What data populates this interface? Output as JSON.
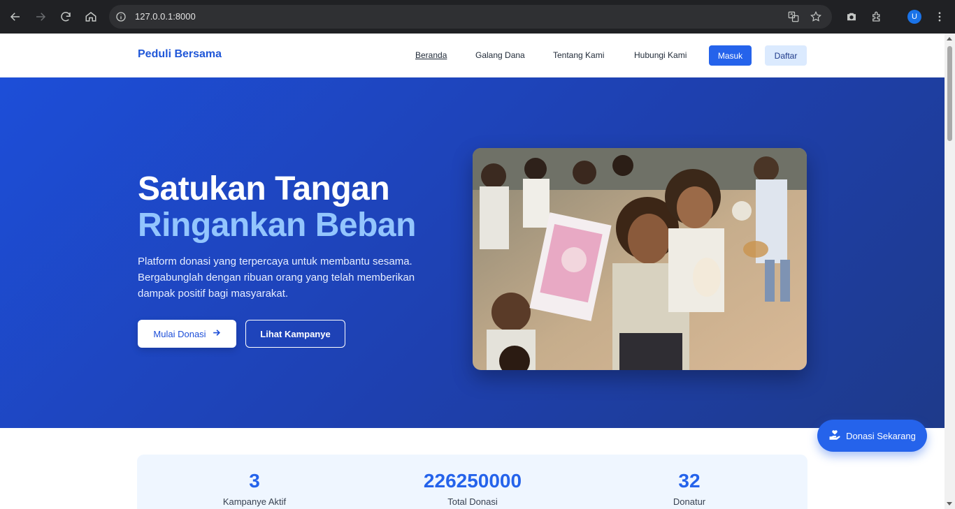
{
  "browser": {
    "url": "127.0.0.1:8000",
    "profile_initial": "U",
    "icons": [
      "back-icon",
      "forward-icon",
      "reload-icon",
      "home-icon",
      "info-icon",
      "translate-icon",
      "star-icon",
      "camera-icon",
      "extensions-icon",
      "menu-icon"
    ]
  },
  "navbar": {
    "brand": "Peduli Bersama",
    "links": [
      "Beranda",
      "Galang Dana",
      "Tentang Kami",
      "Hubungi Kami"
    ],
    "login": "Masuk",
    "register": "Daftar"
  },
  "hero": {
    "title_line1": "Satukan Tangan",
    "title_line2": "Ringankan Beban",
    "description": "Platform donasi yang terpercaya untuk membantu sesama. Bergabunglah dengan ribuan orang yang telah memberikan dampak positif bagi masyarakat.",
    "primary_button": "Mulai Donasi",
    "secondary_button": "Lihat Kampanye"
  },
  "stats": [
    {
      "value": "3",
      "label": "Kampanye Aktif"
    },
    {
      "value": "226250000",
      "label": "Total Donasi"
    },
    {
      "value": "32",
      "label": "Donatur"
    }
  ],
  "floating_button": "Donasi Sekarang",
  "colors": {
    "primary": "#2563eb",
    "hero_accent": "#93c5fd",
    "stats_bg": "#eff6ff"
  }
}
